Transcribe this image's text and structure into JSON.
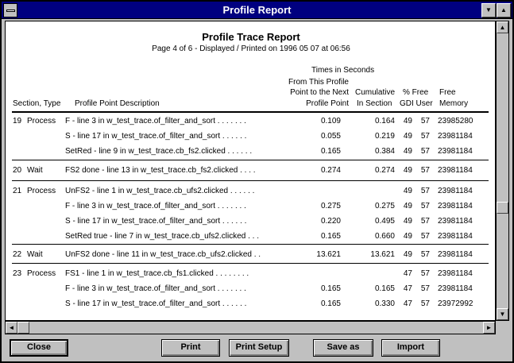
{
  "window": {
    "title": "Profile Report",
    "sysmenu_icon": "system-menu-icon",
    "minimize_icon": "minimize-arrow-icon",
    "maximize_icon": "maximize-arrow-icon",
    "minimize_glyph": "▼",
    "maximize_glyph": "▲"
  },
  "report": {
    "title": "Profile Trace Report",
    "subtitle": "Page 4 of 6 - Displayed / Printed on 1996 05 07 at 06:56",
    "headers": {
      "times_group": "Times in Seconds",
      "section_type": "Section, Type",
      "description": "Profile Point Description",
      "from_this_1": "From This Profile",
      "from_this_2": "Point to the Next",
      "from_this_3": "Profile Point",
      "cumulative_1": "Cumulative",
      "cumulative_2": "In Section",
      "pct_free_1": "% Free",
      "pct_free_2": "GDI User",
      "free_1": "Free",
      "free_2": "Memory"
    },
    "rows": [
      {
        "section": "19",
        "type": "Process",
        "desc": "F - line 3 in w_test_trace.of_filter_and_sort  .  .  .  .  .  .  .",
        "from": "0.109",
        "cum": "0.164",
        "gdi": "49",
        "user": "57",
        "mem": "23985280"
      },
      {
        "section": "",
        "type": "",
        "desc": "S - line 17 in w_test_trace.of_filter_and_sort  .  .  .  .  .  .",
        "from": "0.055",
        "cum": "0.219",
        "gdi": "49",
        "user": "57",
        "mem": "23981184"
      },
      {
        "section": "",
        "type": "",
        "desc": "SetRed - line 9 in w_test_trace.cb_fs2.clicked  .  .  .  .  .  .",
        "from": "0.165",
        "cum": "0.384",
        "gdi": "49",
        "user": "57",
        "mem": "23981184"
      },
      {
        "section": "20",
        "type": "Wait",
        "desc": "FS2 done - line 13 in w_test_trace.cb_fs2.clicked  .  .  .  .",
        "from": "0.274",
        "cum": "0.274",
        "gdi": "49",
        "user": "57",
        "mem": "23981184"
      },
      {
        "section": "21",
        "type": "Process",
        "desc": "UnFS2 - line 1 in w_test_trace.cb_ufs2.clicked  .  .  .  .  .  .",
        "from": "",
        "cum": "",
        "gdi": "49",
        "user": "57",
        "mem": "23981184"
      },
      {
        "section": "",
        "type": "",
        "desc": "F - line 3 in w_test_trace.of_filter_and_sort  .  .  .  .  .  .  .",
        "from": "0.275",
        "cum": "0.275",
        "gdi": "49",
        "user": "57",
        "mem": "23981184"
      },
      {
        "section": "",
        "type": "",
        "desc": "S - line 17 in w_test_trace.of_filter_and_sort  .  .  .  .  .  .",
        "from": "0.220",
        "cum": "0.495",
        "gdi": "49",
        "user": "57",
        "mem": "23981184"
      },
      {
        "section": "",
        "type": "",
        "desc": "SetRed true - line 7 in w_test_trace.cb_ufs2.clicked  .  .  .",
        "from": "0.165",
        "cum": "0.660",
        "gdi": "49",
        "user": "57",
        "mem": "23981184"
      },
      {
        "section": "22",
        "type": "Wait",
        "desc": "UnFS2 done - line 11 in w_test_trace.cb_ufs2.clicked  .  .",
        "from": "13.621",
        "cum": "13.621",
        "gdi": "49",
        "user": "57",
        "mem": "23981184"
      },
      {
        "section": "23",
        "type": "Process",
        "desc": "FS1 - line 1 in w_test_trace.cb_fs1.clicked  .  .  .  .  .  .  .  .",
        "from": "",
        "cum": "",
        "gdi": "47",
        "user": "57",
        "mem": "23981184"
      },
      {
        "section": "",
        "type": "",
        "desc": "F - line 3 in w_test_trace.of_filter_and_sort  .  .  .  .  .  .  .",
        "from": "0.165",
        "cum": "0.165",
        "gdi": "47",
        "user": "57",
        "mem": "23981184"
      },
      {
        "section": "",
        "type": "",
        "desc": "S - line 17 in w_test_trace.of_filter_and_sort  .  .  .  .  .  .",
        "from": "0.165",
        "cum": "0.330",
        "gdi": "47",
        "user": "57",
        "mem": "23972992"
      }
    ]
  },
  "scrollbars": {
    "up_glyph": "▲",
    "down_glyph": "▼",
    "left_glyph": "◄",
    "right_glyph": "►",
    "vertical_position": 0.64,
    "horizontal_position": 0
  },
  "buttons": {
    "close": "Close",
    "print": "Print",
    "print_setup": "Print Setup",
    "save_as": "Save as",
    "import": "Import"
  }
}
